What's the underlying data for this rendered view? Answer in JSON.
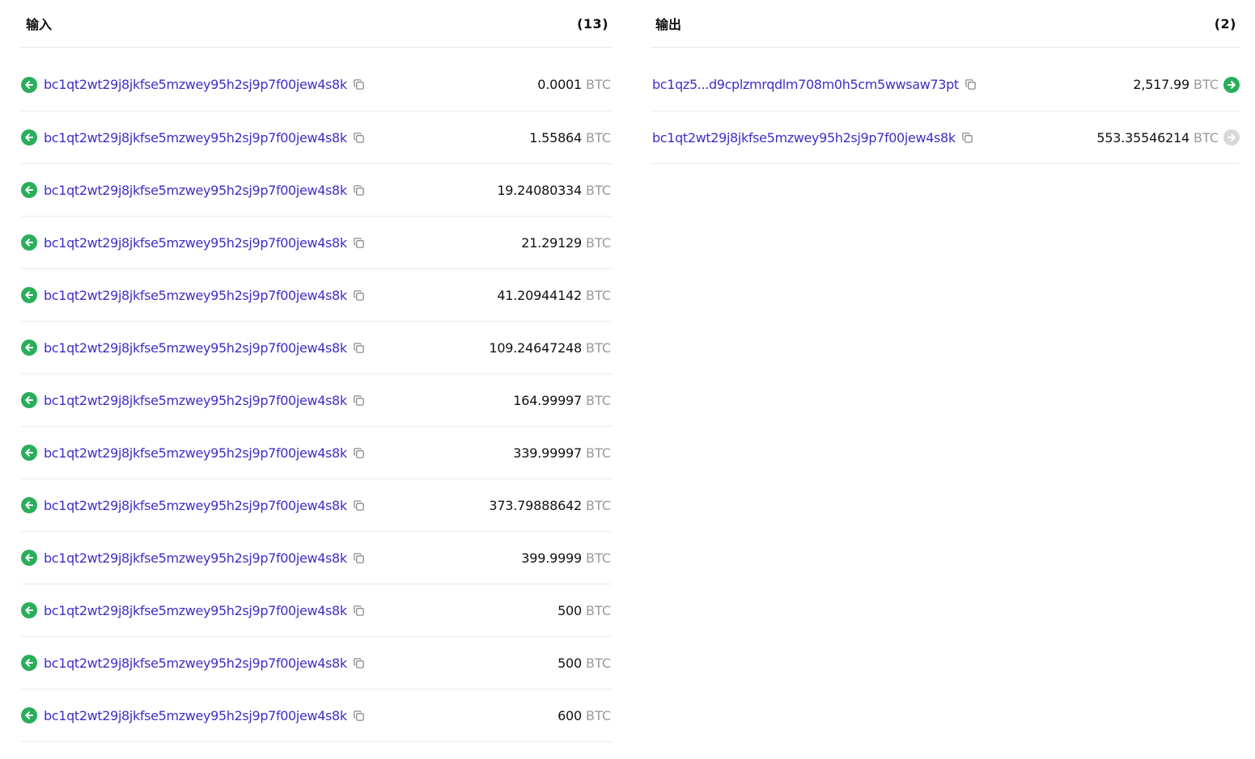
{
  "inputs": {
    "title": "输入",
    "count": "(13)",
    "rows": [
      {
        "address": "bc1qt2wt29j8jkfse5mzwey95h2sj9p7f00jew4s8k",
        "amount": "0.0001",
        "unit": "BTC"
      },
      {
        "address": "bc1qt2wt29j8jkfse5mzwey95h2sj9p7f00jew4s8k",
        "amount": "1.55864",
        "unit": "BTC"
      },
      {
        "address": "bc1qt2wt29j8jkfse5mzwey95h2sj9p7f00jew4s8k",
        "amount": "19.24080334",
        "unit": "BTC"
      },
      {
        "address": "bc1qt2wt29j8jkfse5mzwey95h2sj9p7f00jew4s8k",
        "amount": "21.29129",
        "unit": "BTC"
      },
      {
        "address": "bc1qt2wt29j8jkfse5mzwey95h2sj9p7f00jew4s8k",
        "amount": "41.20944142",
        "unit": "BTC"
      },
      {
        "address": "bc1qt2wt29j8jkfse5mzwey95h2sj9p7f00jew4s8k",
        "amount": "109.24647248",
        "unit": "BTC"
      },
      {
        "address": "bc1qt2wt29j8jkfse5mzwey95h2sj9p7f00jew4s8k",
        "amount": "164.99997",
        "unit": "BTC"
      },
      {
        "address": "bc1qt2wt29j8jkfse5mzwey95h2sj9p7f00jew4s8k",
        "amount": "339.99997",
        "unit": "BTC"
      },
      {
        "address": "bc1qt2wt29j8jkfse5mzwey95h2sj9p7f00jew4s8k",
        "amount": "373.79888642",
        "unit": "BTC"
      },
      {
        "address": "bc1qt2wt29j8jkfse5mzwey95h2sj9p7f00jew4s8k",
        "amount": "399.9999",
        "unit": "BTC"
      },
      {
        "address": "bc1qt2wt29j8jkfse5mzwey95h2sj9p7f00jew4s8k",
        "amount": "500",
        "unit": "BTC"
      },
      {
        "address": "bc1qt2wt29j8jkfse5mzwey95h2sj9p7f00jew4s8k",
        "amount": "500",
        "unit": "BTC"
      },
      {
        "address": "bc1qt2wt29j8jkfse5mzwey95h2sj9p7f00jew4s8k",
        "amount": "600",
        "unit": "BTC"
      }
    ]
  },
  "outputs": {
    "title": "输出",
    "count": "(2)",
    "rows": [
      {
        "address": "bc1qz5...d9cplzmrqdlm708m0h5cm5wwsaw73pt",
        "amount": "2,517.99",
        "unit": "BTC",
        "arrow_state": "spent"
      },
      {
        "address": "bc1qt2wt29j8jkfse5mzwey95h2sj9p7f00jew4s8k",
        "amount": "553.35546214",
        "unit": "BTC",
        "arrow_state": "unspent"
      }
    ]
  },
  "icons": {
    "input_arrow": "arrow-left-circle-icon",
    "output_arrow": "arrow-right-circle-icon",
    "copy": "copy-icon"
  },
  "colors": {
    "address_link": "#3f2ec6",
    "arrow_green": "#2aae5c",
    "arrow_grey": "#d8d8d8",
    "unit_grey": "#9a9a9a"
  }
}
